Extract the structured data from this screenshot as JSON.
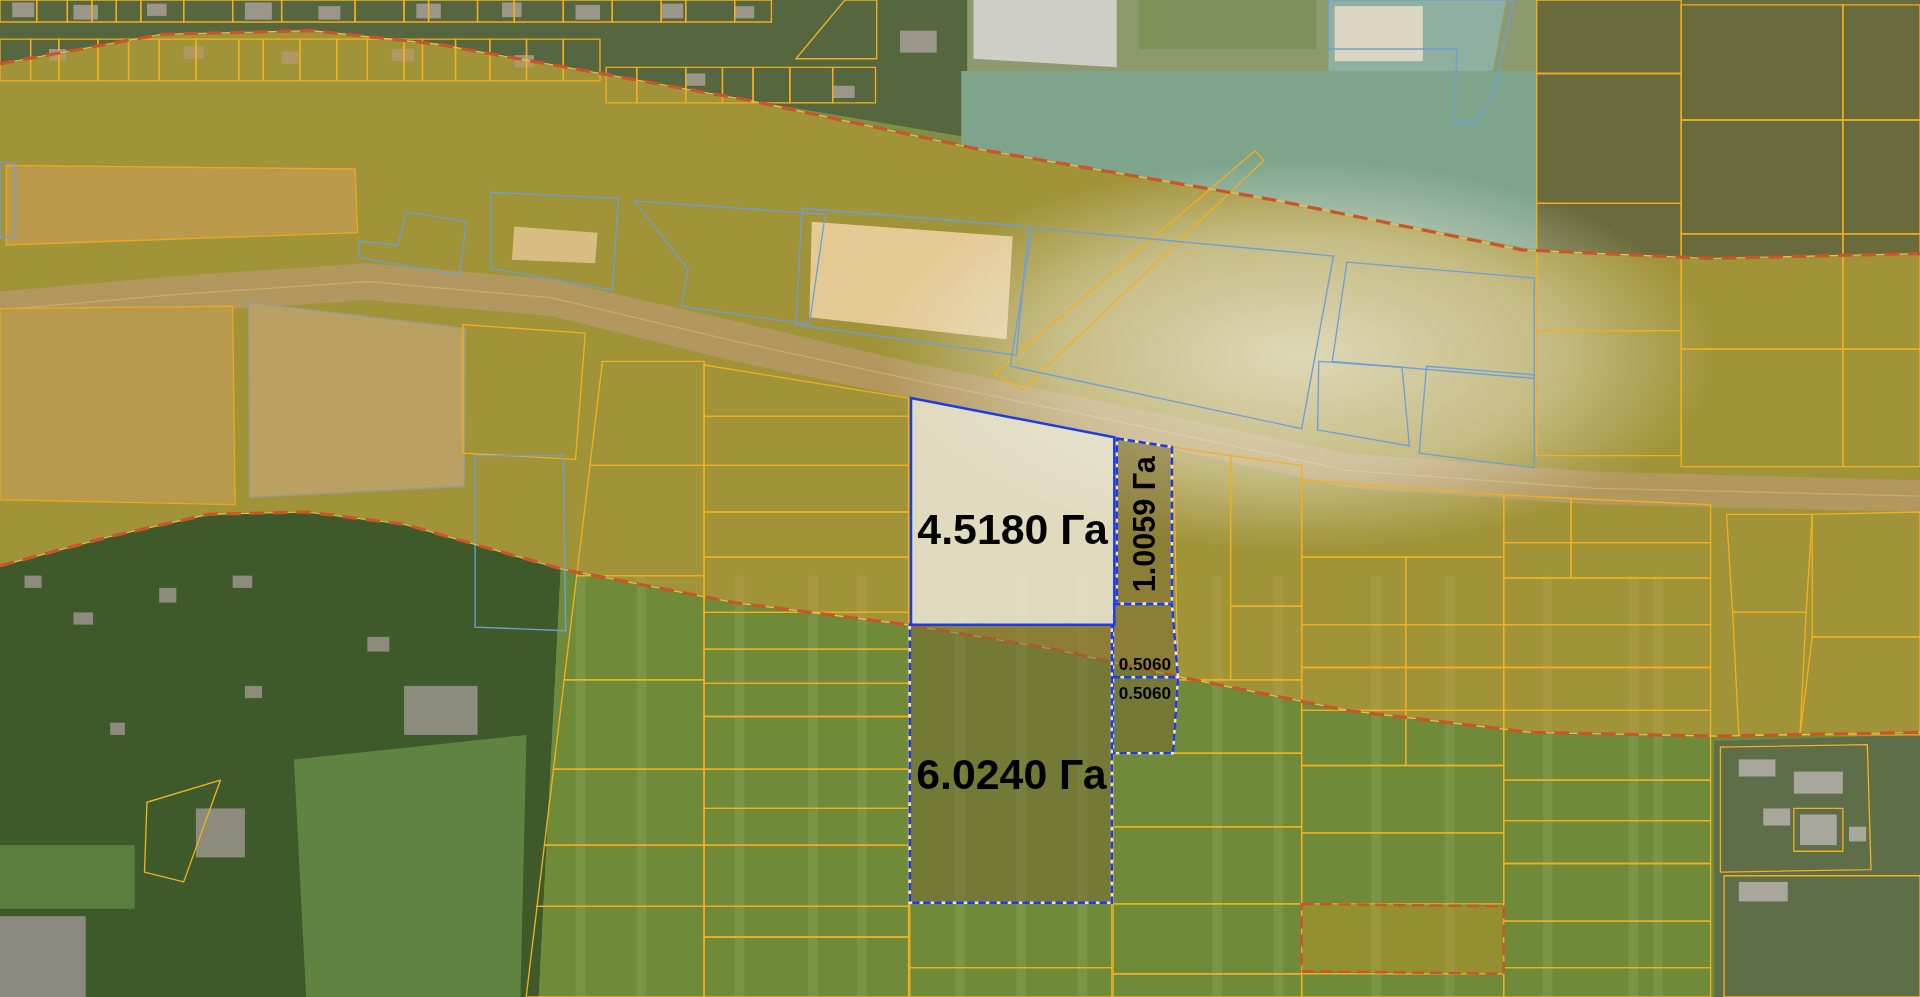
{
  "map": {
    "parcels": [
      {
        "area": "4.5180 Га",
        "selected": true
      },
      {
        "area": "1.0059 Га",
        "selected": false
      },
      {
        "area": "0.5060",
        "selected": false
      },
      {
        "area": "0.5060",
        "selected": false
      },
      {
        "area": "6.0240 Га",
        "selected": false
      }
    ]
  }
}
